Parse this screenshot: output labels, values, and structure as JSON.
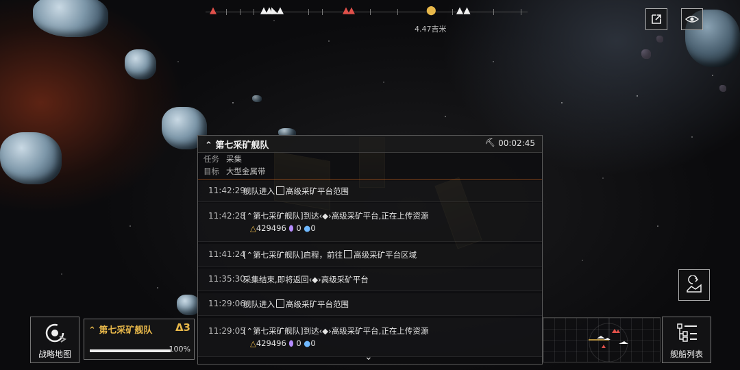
{
  "compass": {
    "distance": "4.47吉米",
    "markers": [
      {
        "icon": "red-triangle-marker",
        "color": "#e0504a"
      },
      {
        "icon": "white-fleet-marker",
        "color": "#f2f2f2"
      },
      {
        "icon": "red-fleet-marker",
        "color": "#e0504a"
      },
      {
        "icon": "gold-location-pin",
        "color": "#e8b84a"
      },
      {
        "icon": "white-fleet-marker",
        "color": "#f2f2f2"
      }
    ]
  },
  "top_buttons": {
    "share_icon": "external-link-icon",
    "view_icon": "eye-icon"
  },
  "panel": {
    "title": "第七采矿舰队",
    "timer": "00:02:45",
    "task_label": "任务",
    "task_value": "采集",
    "target_label": "目标",
    "target_value": "大型金属带",
    "logs": [
      {
        "time": "11:42:29",
        "pre": "舰队进入",
        "post": "高级采矿平台范围",
        "icon": "square"
      },
      {
        "time": "11:42:28",
        "pre": "[",
        "fleet": "第七采矿舰队",
        "mid": "]到达",
        "post": "高级采矿平台,正在上传资源",
        "icon": "diamond",
        "res": {
          "metal": "429496",
          "crystal": "0",
          "gas": "0"
        }
      },
      {
        "time": "11:41:24",
        "pre": "[",
        "fleet": "第七采矿舰队",
        "mid": "]启程，前往",
        "post": "高级采矿平台区域",
        "icon": "square"
      },
      {
        "time": "11:35:30",
        "pre": "采集结束,即将返回",
        "post": "高级采矿平台",
        "icon": "diamond"
      },
      {
        "time": "11:29:06",
        "pre": "舰队进入",
        "post": "高级采矿平台范围",
        "icon": "square"
      },
      {
        "time": "11:29:05",
        "pre": "[",
        "fleet": "第七采矿舰队",
        "mid": "]到达",
        "post": "高级采矿平台,正在上传资源",
        "icon": "diamond",
        "res": {
          "metal": "429496",
          "crystal": "0",
          "gas": "0"
        }
      }
    ]
  },
  "bottom": {
    "strategy_map_label": "战略地图",
    "fleet_name": "第七采矿舰队",
    "fleet_count": "Δ3",
    "fleet_progress": "100%",
    "fleet_progress_value": 100,
    "ship_list_label": "舰船列表"
  },
  "colors": {
    "accent_gold": "#e8b84a",
    "enemy_red": "#e0504a",
    "separator_orange": "#b0581d"
  }
}
